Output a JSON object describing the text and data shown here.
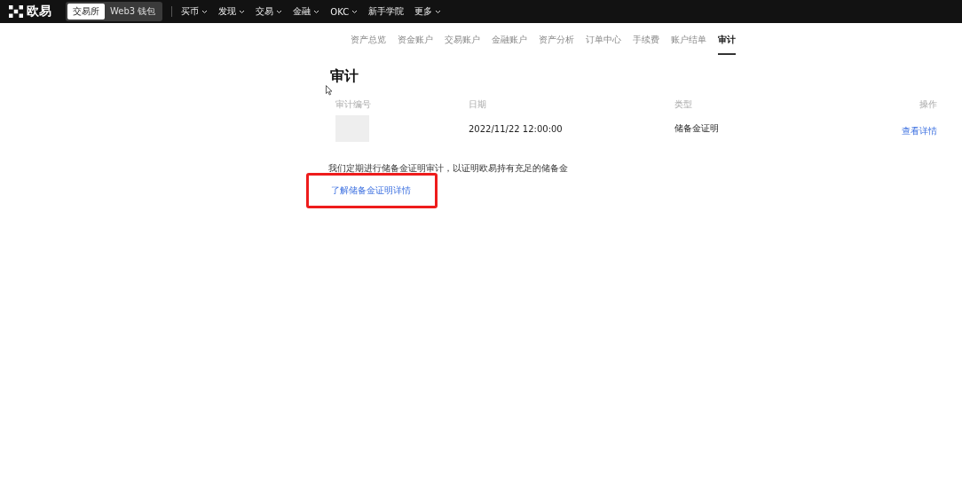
{
  "brand": {
    "name": "欧易"
  },
  "mode_switch": [
    {
      "label": "交易所",
      "selected": true
    },
    {
      "label": "Web3 钱包",
      "selected": false
    }
  ],
  "nav": [
    {
      "label": "买币",
      "dropdown": true
    },
    {
      "label": "发现",
      "dropdown": true
    },
    {
      "label": "交易",
      "dropdown": true
    },
    {
      "label": "金融",
      "dropdown": true
    },
    {
      "label": "OKC",
      "dropdown": true
    },
    {
      "label": "新手学院",
      "dropdown": false
    },
    {
      "label": "更多",
      "dropdown": true
    }
  ],
  "tabs": [
    {
      "label": "资产总览",
      "selected": false
    },
    {
      "label": "资金账户",
      "selected": false
    },
    {
      "label": "交易账户",
      "selected": false
    },
    {
      "label": "金融账户",
      "selected": false
    },
    {
      "label": "资产分析",
      "selected": false
    },
    {
      "label": "订单中心",
      "selected": false
    },
    {
      "label": "手续费",
      "selected": false
    },
    {
      "label": "账户结单",
      "selected": false
    },
    {
      "label": "审计",
      "selected": true
    }
  ],
  "page_title": "审计",
  "table": {
    "columns": [
      "审计编号",
      "日期",
      "类型",
      "操作"
    ],
    "rows": [
      {
        "date": "2022/11/22 12:00:00",
        "type": "储备金证明",
        "action": "查看详情"
      }
    ]
  },
  "note": "我们定期进行储备金证明审计，以证明欧易持有充足的储备金",
  "learn_more_link": "了解储备金证明详情"
}
